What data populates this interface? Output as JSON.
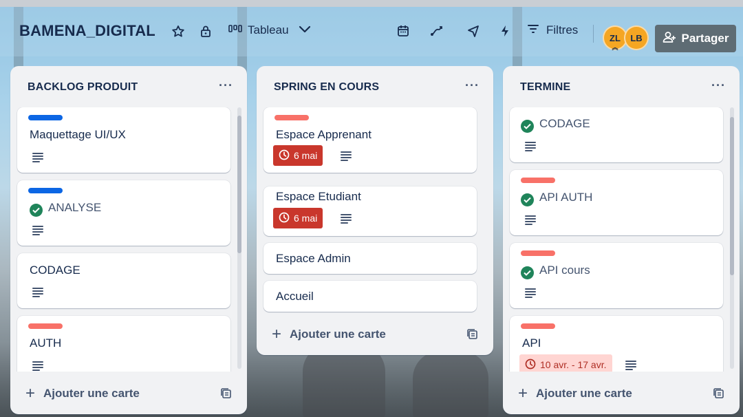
{
  "board": {
    "title": "BAMENA_DIGITAL",
    "view_label": "Tableau",
    "filter_label": "Filtres",
    "share_label": "Partager",
    "members": [
      {
        "initials": "ZL",
        "color": "#f5a623"
      },
      {
        "initials": "LB",
        "color": "#f5a623"
      }
    ]
  },
  "icons": {
    "star": "star-icon",
    "lock": "lock-icon",
    "board_view": "board-view-icon",
    "calendar": "calendar-icon",
    "automation": "automation-icon",
    "power_ups": "rocket-icon",
    "lightning": "lightning-icon",
    "filter": "filter-icon",
    "share": "add-user-icon",
    "description": "description-icon",
    "clock": "clock-icon",
    "check": "check-circle-icon",
    "template": "template-icon"
  },
  "colors": {
    "label_blue": "#0c66e4",
    "label_red": "#f87168",
    "overdue": "#c9372c",
    "due_soon_bg": "#ffd5d2",
    "complete": "#1f845a",
    "share_button": "#5e6c74"
  },
  "lists": [
    {
      "title": "BACKLOG PRODUIT",
      "menu": "···",
      "add_card_label": "Ajouter une carte",
      "cards": [
        {
          "title": "Maquettage UI/UX",
          "label": "blue",
          "has_description": true
        },
        {
          "title": "ANALYSE",
          "label": "blue",
          "complete": true,
          "has_description": true
        },
        {
          "title": "CODAGE",
          "has_description": true
        },
        {
          "title": "AUTH",
          "label": "red",
          "has_description": true
        }
      ]
    },
    {
      "title": "SPRING EN COURS",
      "menu": "···",
      "add_card_label": "Ajouter une carte",
      "cards": [
        {
          "title": "Espace Apprenant",
          "label": "red",
          "due": "6 mai",
          "due_status": "overdue",
          "has_description": true
        },
        {
          "title": "Espace Etudiant",
          "due": "6 mai",
          "due_status": "overdue",
          "has_description": true
        },
        {
          "title": "Espace Admin"
        },
        {
          "title": "Accueil"
        }
      ]
    },
    {
      "title": "TERMINE",
      "menu": "···",
      "add_card_label": "Ajouter une carte",
      "cards": [
        {
          "title": "CODAGE",
          "complete": true,
          "has_description": true
        },
        {
          "title": "API AUTH",
          "label": "red",
          "complete": true,
          "has_description": true
        },
        {
          "title": "API cours",
          "label": "red",
          "complete": true,
          "has_description": true
        },
        {
          "title": "API",
          "label": "red",
          "due": "10 avr. - 17 avr.",
          "due_status": "soon",
          "has_description": true
        }
      ]
    }
  ]
}
